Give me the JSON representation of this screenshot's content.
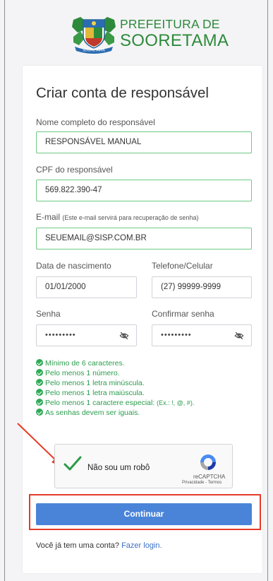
{
  "header": {
    "logo_line1": "PREFEITURA DE",
    "logo_line2": "SOORETAMA",
    "crest_text": "SOORETAMA"
  },
  "form": {
    "title": "Criar conta de responsável",
    "name": {
      "label": "Nome completo do responsável",
      "value": "RESPONSÁVEL MANUAL"
    },
    "cpf": {
      "label": "CPF do responsável",
      "value": "569.822.390-47"
    },
    "email": {
      "label": "E-mail",
      "note": "(Este e-mail servirá para recuperação de senha)",
      "value": "SEUEMAIL@SISP.COM.BR"
    },
    "birthdate": {
      "label": "Data de nascimento",
      "value": "01/01/2000"
    },
    "phone": {
      "label": "Telefone/Celular",
      "value": "(27) 99999-9999"
    },
    "password": {
      "label": "Senha",
      "value": "•••••••••"
    },
    "confirm_password": {
      "label": "Confirmar senha",
      "value": "•••••••••"
    },
    "rules": [
      {
        "text": "Mínimo de 6 caracteres."
      },
      {
        "text": "Pelo menos 1 número."
      },
      {
        "text": "Pelo menos 1 letra minúscula."
      },
      {
        "text": "Pelo menos 1 letra maiúscula."
      },
      {
        "text": "Pelo menos 1 caractere especial:",
        "note": "(Ex.: !, @, #)."
      },
      {
        "text": "As senhas devem ser iguais."
      }
    ],
    "captcha": {
      "label": "Não sou um robô",
      "brand": "reCAPTCHA",
      "terms": "Privacidade - Termos"
    },
    "submit_label": "Continuar",
    "footer_text": "Você já tem uma conta?",
    "footer_link": "Fazer login."
  },
  "colors": {
    "brand_green": "#2d8a3b",
    "valid_border": "#6cc983",
    "rule_green": "#2b9c4d",
    "button_blue": "#4a84d9",
    "annotation_red": "#e53b26"
  }
}
